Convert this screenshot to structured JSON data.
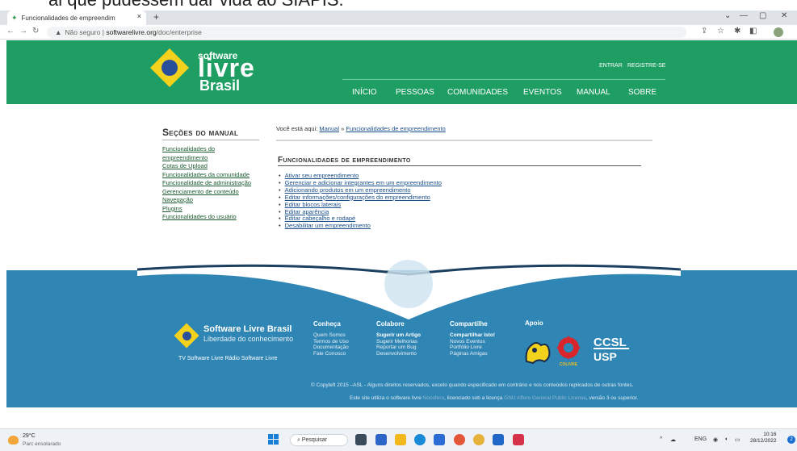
{
  "overlay_text": "ai que pudessem dar vida ao SIAPIS.",
  "browser": {
    "tab_title": "Funcionalidades de empreendim",
    "close": "×",
    "new_tab": "+",
    "insecure_label": "Não seguro",
    "host": "softwarelivre.org",
    "path": "/doc/enterprise"
  },
  "site": {
    "logo_software": "software",
    "logo_livre": "livre",
    "logo_brasil": "Brasil",
    "login": "ENTRAR",
    "register": "REGISTRE-SE",
    "nav": [
      "INÍCIO",
      "PESSOAS",
      "COMUNIDADES",
      "EVENTOS",
      "MANUAL",
      "SOBRE"
    ]
  },
  "sidebar": {
    "title": "Seções do manual",
    "items": [
      "Funcionalidades do",
      "empreendimento",
      "Cotas de Upload",
      "Funcionalidades da comunidade",
      "Funcionalidade de administração",
      "Gerenciamento de conteúdo",
      "Navegação",
      "Plugins",
      "Funcionalidades do usuário"
    ]
  },
  "content": {
    "breadcrumb_prefix": "Você está aqui:",
    "breadcrumb_manual": "Manual",
    "breadcrumb_sep": "»",
    "breadcrumb_current": "Funcionalidades de empreendimento",
    "title": "Funcionalidades de empreendimento",
    "items": [
      "Ativar seu empreendimento",
      "Gerenciar e adicionar integrantes em um empreendimento",
      "Adicionando produtos em um empreendimento",
      "Editar informações/configurações do empreendimento",
      "Editar blocos laterais",
      "Editar aparência",
      "Editar cabeçalho e rodapé",
      "Desabilitar um empreendimento"
    ]
  },
  "footer": {
    "brand": "Software Livre Brasil",
    "slogan": "Liberdade do conhecimento",
    "links": "TV Software Livre    Rádio Software Livre",
    "cols": [
      {
        "title": "Conheça",
        "items": [
          "Quem Somos",
          "Termos de Uso",
          "Documentação",
          "Fale Conosco"
        ]
      },
      {
        "title": "Colabore",
        "items": [
          "Sugerir um Artigo",
          "Sugerir Melhorias",
          "Reportar um Bug",
          "Desenvolvimento"
        ]
      },
      {
        "title": "Compartilhe",
        "items": [
          "Compartilhar Isto!",
          "Novos Eventos",
          "Portfólio Livre",
          "Páginas Amigas"
        ]
      }
    ],
    "apoio": "Apoio",
    "sponsor_colivre": "COLIVRE",
    "sponsor_ccsl": "CCSL",
    "sponsor_usp": "USP",
    "copyright": "© Copyleft 2015 –ASL - Alguns direitos reservados, exceto quando especificado em contrário e nos conteúdos replicados de outras fontes.",
    "license_a": "Este site utiliza o software livre",
    "license_noosfero": "Noosfero",
    "license_b": ", licenciado sob a licença",
    "license_gnu": "GNU Affero General Public License",
    "license_c": ", versão 3 ou superior."
  },
  "taskbar": {
    "temp": "29°C",
    "weather": "Parc ensolarado",
    "search": "Pesquisar",
    "lang": "ENG",
    "time": "10:16",
    "date": "28/12/2022"
  },
  "colors": {
    "header_green": "#1f9e63",
    "footer_blue": "#2f85b4",
    "link": "#1a4f8a"
  }
}
